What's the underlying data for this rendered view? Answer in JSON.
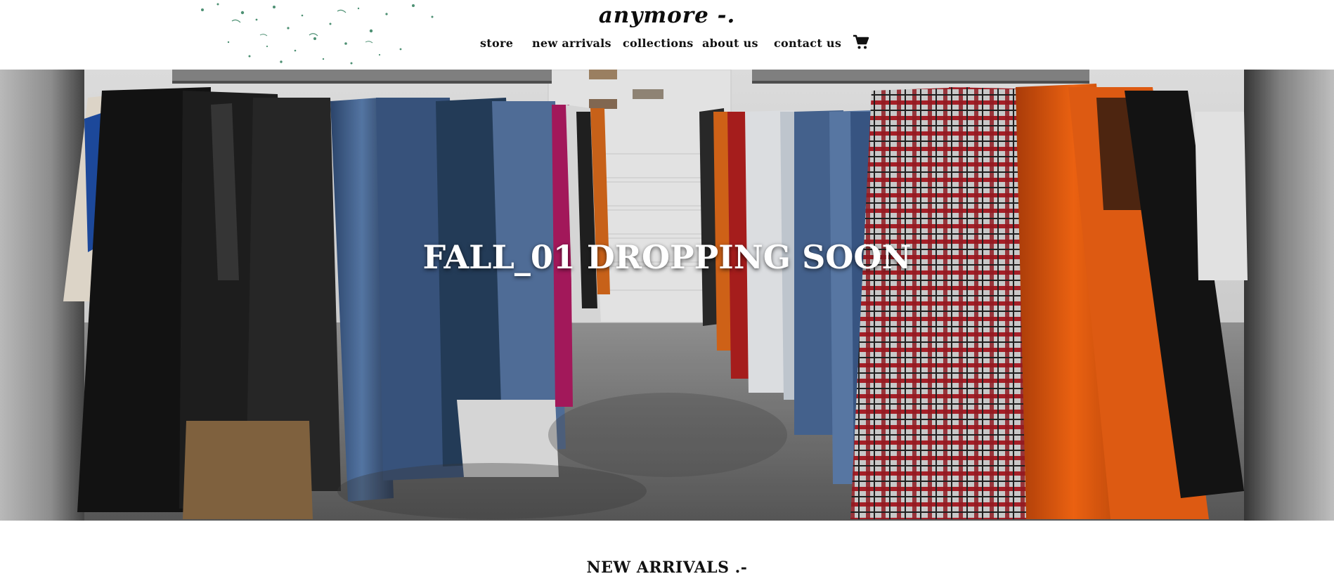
{
  "brand": {
    "name": "anymore -."
  },
  "nav": {
    "items": [
      {
        "label": "store"
      },
      {
        "label": "new arrivals"
      },
      {
        "label": "collections"
      },
      {
        "label": "about us"
      },
      {
        "label": "contact us"
      }
    ],
    "cart_icon": "shopping-cart-icon"
  },
  "hero": {
    "title": "FALL_01 DROPPING SOON"
  },
  "sections": {
    "new_arrivals_title": "NEW ARRIVALS .-"
  },
  "colors": {
    "background": "#ffffff",
    "text": "#111111",
    "splatter": "#2e7d5b",
    "hero_text": "#ffffff"
  }
}
